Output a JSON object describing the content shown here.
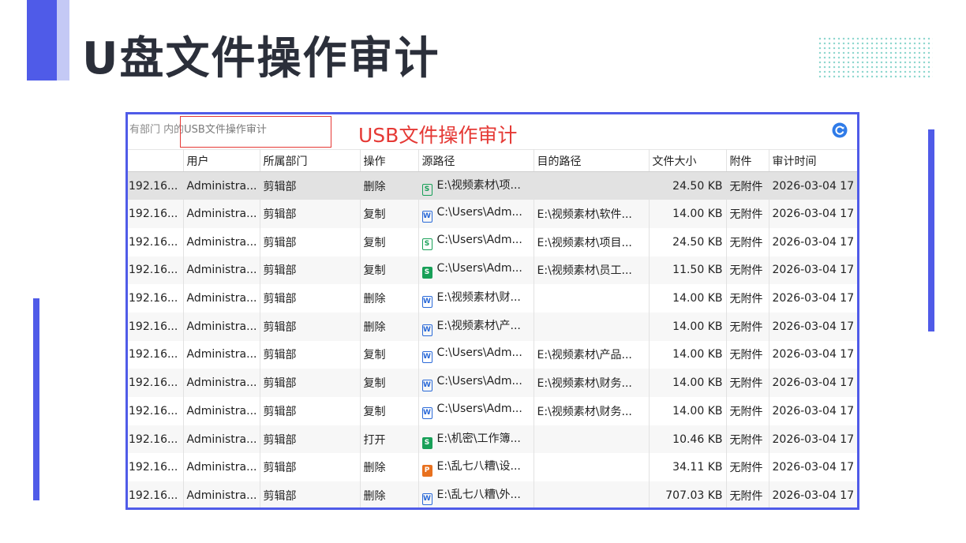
{
  "title": "U盘文件操作审计",
  "breadcrumb": {
    "prefix": "有部门 内的",
    "highlight": "USB文件操作审计"
  },
  "annotation": "USB文件操作审计",
  "colors": {
    "accent": "#4f5be8",
    "annotation": "#e53935",
    "title": "#2b2f3a"
  },
  "refresh_icon": "refresh-icon",
  "table": {
    "columns": [
      "",
      "用户",
      "所属部门",
      "操作",
      "源路径",
      "目的路径",
      "文件大小",
      "附件",
      "审计时间"
    ],
    "rows": [
      {
        "ip": "192.16...",
        "user": "Administra...",
        "dept": "剪辑部",
        "op": "删除",
        "icon": "sheet",
        "src": "E:\\视频素材\\项...",
        "dst": "",
        "size": "24.50 KB",
        "att": "无附件",
        "time": "2026-03-04 17"
      },
      {
        "ip": "192.16...",
        "user": "Administra...",
        "dept": "剪辑部",
        "op": "复制",
        "icon": "word",
        "src": "C:\\Users\\Adm...",
        "dst": "E:\\视频素材\\软件...",
        "size": "14.00 KB",
        "att": "无附件",
        "time": "2026-03-04 17"
      },
      {
        "ip": "192.16...",
        "user": "Administra...",
        "dept": "剪辑部",
        "op": "复制",
        "icon": "sheet",
        "src": "C:\\Users\\Adm...",
        "dst": "E:\\视频素材\\项目...",
        "size": "24.50 KB",
        "att": "无附件",
        "time": "2026-03-04 17"
      },
      {
        "ip": "192.16...",
        "user": "Administra...",
        "dept": "剪辑部",
        "op": "复制",
        "icon": "sheet-solid",
        "src": "C:\\Users\\Adm...",
        "dst": "E:\\视频素材\\员工...",
        "size": "11.50 KB",
        "att": "无附件",
        "time": "2026-03-04 17"
      },
      {
        "ip": "192.16...",
        "user": "Administra...",
        "dept": "剪辑部",
        "op": "删除",
        "icon": "word",
        "src": "E:\\视频素材\\财...",
        "dst": "",
        "size": "14.00 KB",
        "att": "无附件",
        "time": "2026-03-04 17"
      },
      {
        "ip": "192.16...",
        "user": "Administra...",
        "dept": "剪辑部",
        "op": "删除",
        "icon": "word",
        "src": "E:\\视频素材\\产...",
        "dst": "",
        "size": "14.00 KB",
        "att": "无附件",
        "time": "2026-03-04 17"
      },
      {
        "ip": "192.16...",
        "user": "Administra...",
        "dept": "剪辑部",
        "op": "复制",
        "icon": "word",
        "src": "C:\\Users\\Adm...",
        "dst": "E:\\视频素材\\产品...",
        "size": "14.00 KB",
        "att": "无附件",
        "time": "2026-03-04 17"
      },
      {
        "ip": "192.16...",
        "user": "Administra...",
        "dept": "剪辑部",
        "op": "复制",
        "icon": "word",
        "src": "C:\\Users\\Adm...",
        "dst": "E:\\视频素材\\财务...",
        "size": "14.00 KB",
        "att": "无附件",
        "time": "2026-03-04 17"
      },
      {
        "ip": "192.16...",
        "user": "Administra...",
        "dept": "剪辑部",
        "op": "复制",
        "icon": "word",
        "src": "C:\\Users\\Adm...",
        "dst": "E:\\视频素材\\财务...",
        "size": "14.00 KB",
        "att": "无附件",
        "time": "2026-03-04 17"
      },
      {
        "ip": "192.16...",
        "user": "Administra...",
        "dept": "剪辑部",
        "op": "打开",
        "icon": "sheet-solid",
        "src": "E:\\机密\\工作簿...",
        "dst": "",
        "size": "10.46 KB",
        "att": "无附件",
        "time": "2026-03-04 17"
      },
      {
        "ip": "192.16...",
        "user": "Administra...",
        "dept": "剪辑部",
        "op": "删除",
        "icon": "ppt",
        "src": "E:\\乱七八糟\\设...",
        "dst": "",
        "size": "34.11 KB",
        "att": "无附件",
        "time": "2026-03-04 17"
      },
      {
        "ip": "192.16...",
        "user": "Administra...",
        "dept": "剪辑部",
        "op": "删除",
        "icon": "word",
        "src": "E:\\乱七八糟\\外...",
        "dst": "",
        "size": "707.03 KB",
        "att": "无附件",
        "time": "2026-03-04 17"
      }
    ]
  }
}
